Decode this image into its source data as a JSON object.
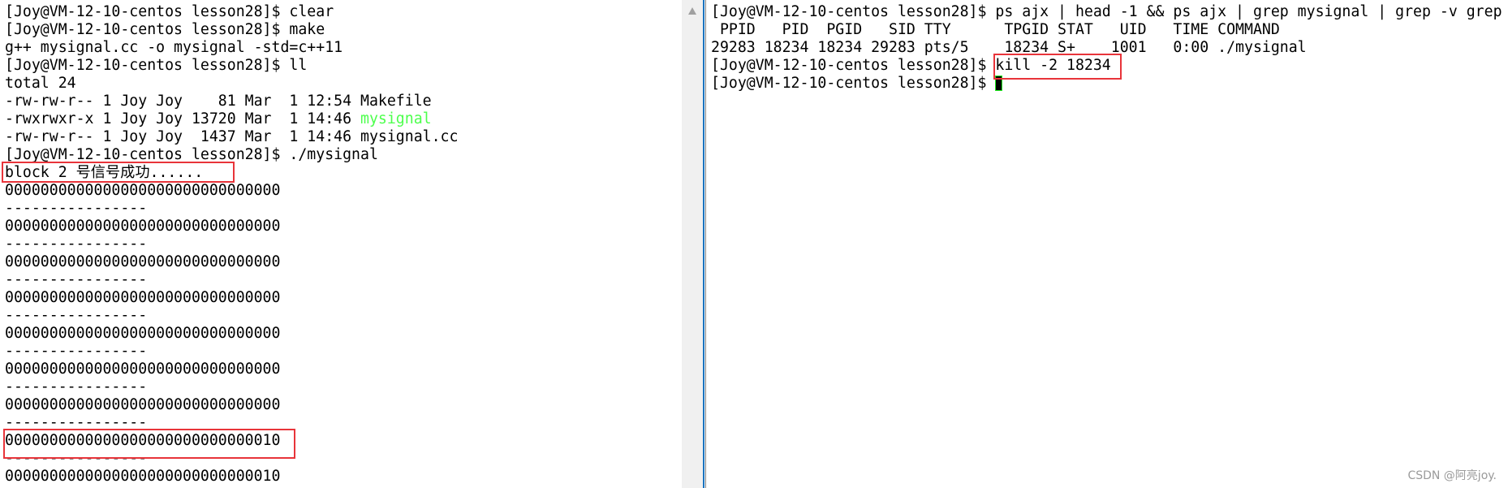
{
  "left_terminal": {
    "lines": [
      "[Joy@VM-12-10-centos lesson28]$ clear",
      "[Joy@VM-12-10-centos lesson28]$ make",
      "g++ mysignal.cc -o mysignal -std=c++11",
      "[Joy@VM-12-10-centos lesson28]$ ll",
      "total 24",
      "-rw-rw-r-- 1 Joy Joy    81 Mar  1 12:54 Makefile",
      "-rwxrwxr-x 1 Joy Joy 13720 Mar  1 14:46 ",
      "-rw-rw-r-- 1 Joy Joy  1437 Mar  1 14:46 mysignal.cc",
      "[Joy@VM-12-10-centos lesson28]$ ./mysignal",
      "block 2 号信号成功......",
      "0000000000000000000000000000000",
      "----------------",
      "0000000000000000000000000000000",
      "----------------",
      "0000000000000000000000000000000",
      "----------------",
      "0000000000000000000000000000000",
      "----------------",
      "0000000000000000000000000000000",
      "----------------",
      "0000000000000000000000000000000",
      "----------------",
      "0000000000000000000000000000000",
      "----------------",
      "0000000000000000000000000000010",
      "----------------",
      "0000000000000000000000000000010"
    ],
    "executable_name": "mysignal",
    "executable_color": "#4cff4c"
  },
  "right_terminal": {
    "lines": [
      "[Joy@VM-12-10-centos lesson28]$ ps ajx | head -1 && ps ajx | grep mysignal | grep -v grep",
      " PPID   PID  PGID   SID TTY      TPGID STAT   UID   TIME COMMAND",
      "29283 18234 18234 29283 pts/5    18234 S+    1001   0:00 ./mysignal",
      "[Joy@VM-12-10-centos lesson28]$ kill -2 18234",
      "[Joy@VM-12-10-centos lesson28]$ "
    ]
  },
  "highlight_color": "#e8343a",
  "watermark": "CSDN @阿亮joy."
}
